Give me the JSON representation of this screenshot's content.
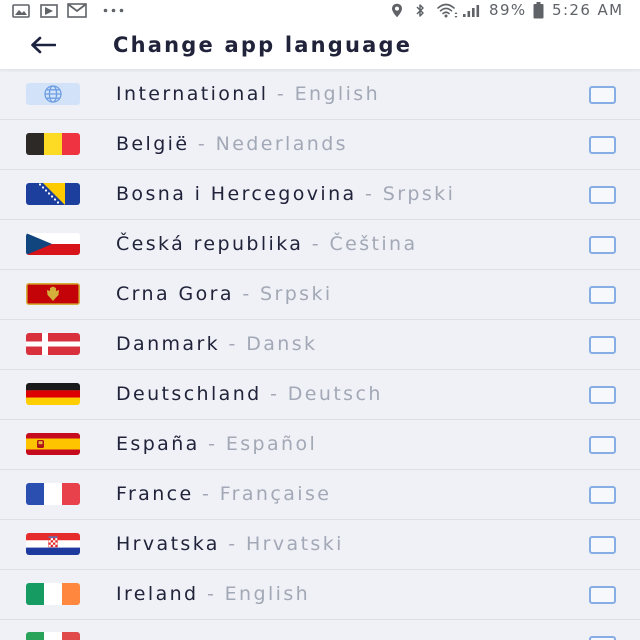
{
  "theme": {
    "accent": "#86ade4",
    "text_primary": "#20233a",
    "text_muted": "#a2a8b5",
    "list_background": "#eff1f6",
    "divider": "#dcdfe7"
  },
  "status_bar": {
    "left_icons": [
      "gallery-icon",
      "play-icon",
      "gmail-icon",
      "more-notifications-icon"
    ],
    "right_icons": [
      "location-icon",
      "bluetooth-icon",
      "wifi-icon",
      "signal-icon",
      "battery-icon"
    ],
    "battery": "89%",
    "time": "5:26 AM"
  },
  "header": {
    "back_icon": "back-arrow-icon",
    "title": "Change app language"
  },
  "list": {
    "separator": " - ",
    "items": [
      {
        "country": "International",
        "language": "English",
        "icon": "globe-icon",
        "checked": false
      },
      {
        "country": "België",
        "language": "Nederlands",
        "icon": "belgium-flag-icon",
        "checked": false
      },
      {
        "country": "Bosna i Hercegovina",
        "language": "Srpski",
        "icon": "bosnia-flag-icon",
        "checked": false
      },
      {
        "country": "Česká republika",
        "language": "Čeština",
        "icon": "czech-flag-icon",
        "checked": false
      },
      {
        "country": "Crna Gora",
        "language": "Srpski",
        "icon": "montenegro-flag-icon",
        "checked": false
      },
      {
        "country": "Danmark",
        "language": "Dansk",
        "icon": "denmark-flag-icon",
        "checked": false
      },
      {
        "country": "Deutschland",
        "language": "Deutsch",
        "icon": "germany-flag-icon",
        "checked": false
      },
      {
        "country": "España",
        "language": "Español",
        "icon": "spain-flag-icon",
        "checked": false
      },
      {
        "country": "France",
        "language": "Française",
        "icon": "france-flag-icon",
        "checked": false
      },
      {
        "country": "Hrvatska",
        "language": "Hrvatski",
        "icon": "croatia-flag-icon",
        "checked": false
      },
      {
        "country": "Ireland",
        "language": "English",
        "icon": "ireland-flag-icon",
        "checked": false
      },
      {
        "icon": "italy-flag-icon",
        "checked": false
      }
    ]
  }
}
